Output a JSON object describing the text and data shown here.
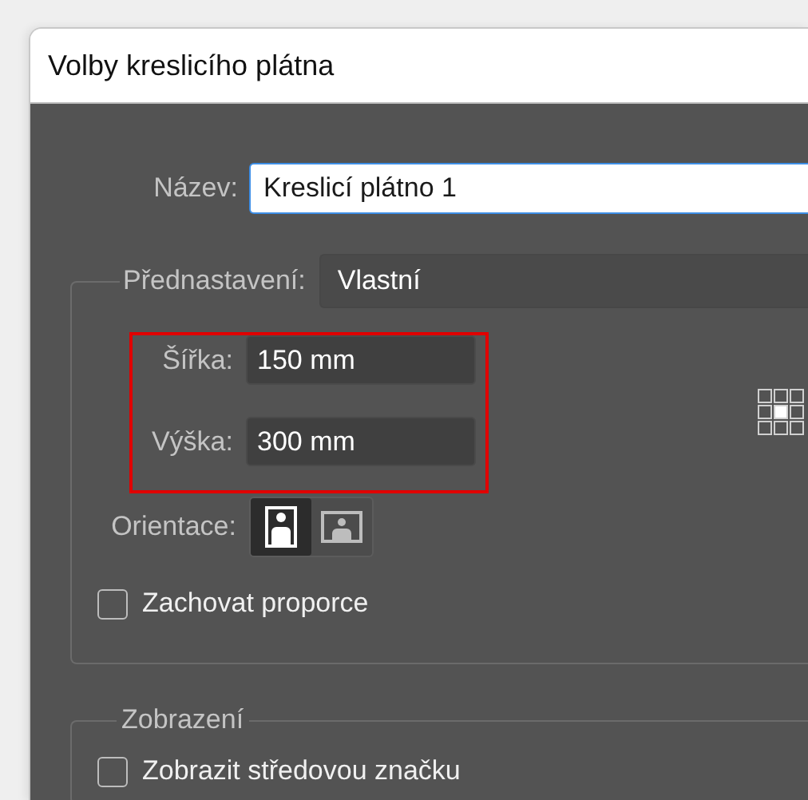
{
  "window": {
    "title": "Volby kreslicího plátna"
  },
  "name": {
    "label": "Název:",
    "value": "Kreslicí plátno 1"
  },
  "preset": {
    "label": "Přednastavení:",
    "value": "Vlastní"
  },
  "size_fields": [
    {
      "label": "Šířka:",
      "value": "150 mm"
    },
    {
      "label": "Výška:",
      "value": "300 mm"
    }
  ],
  "orientation": {
    "label": "Orientace:",
    "options": [
      {
        "kind": "portrait",
        "selected": true
      },
      {
        "kind": "landscape",
        "selected": false
      }
    ]
  },
  "keep_proportions": {
    "label": "Zachovat proporce",
    "checked": false
  },
  "display": {
    "legend": "Zobrazení",
    "options": [
      {
        "label": "Zobrazit středovou značku",
        "checked": false
      }
    ]
  }
}
